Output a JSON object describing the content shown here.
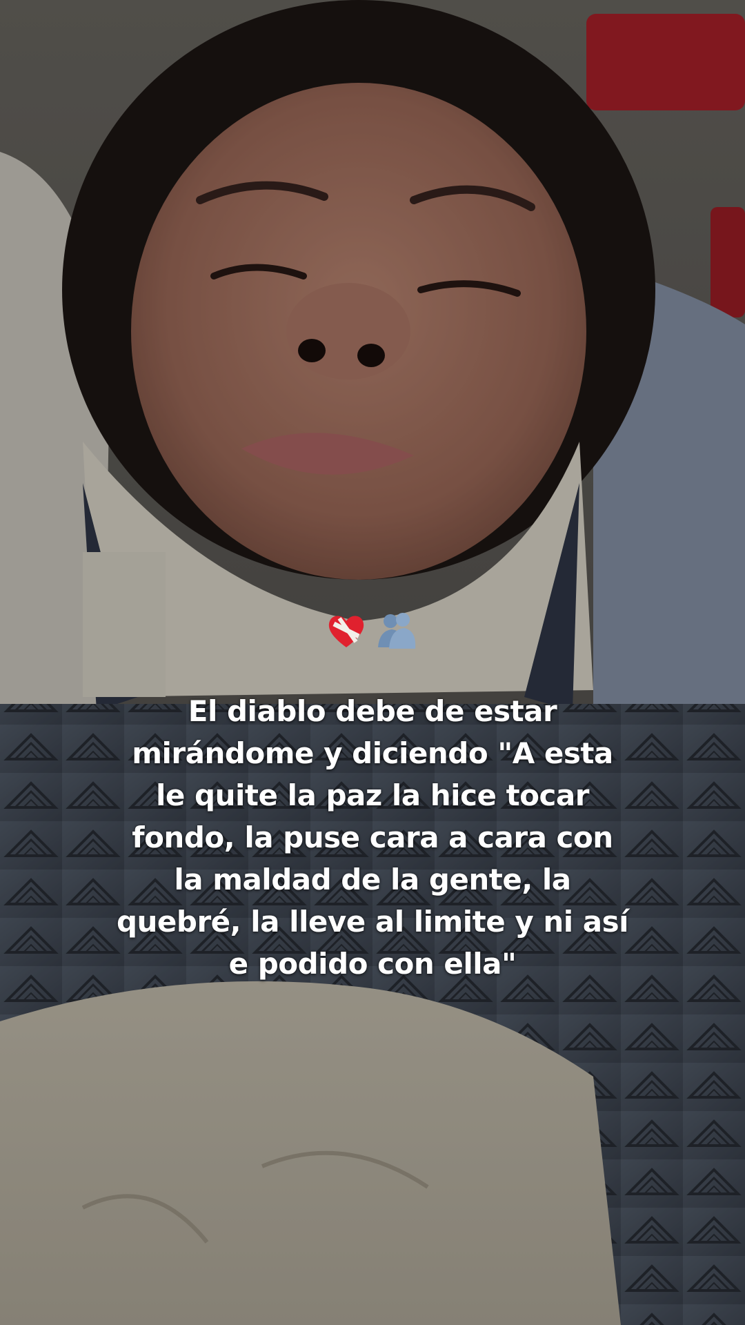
{
  "caption": {
    "text": "El diablo debe de estar\nmirándome y diciendo \"A esta\nle quite la paz la hice tocar\nfondo, la puse cara a cara con\nla maldad de la gente, la\nquebré, la lleve al limite y ni así\ne podido con ella\"",
    "emojis": [
      "mending-heart-emoji",
      "people-hugging-emoji"
    ],
    "color": "#ffffff"
  },
  "palette": {
    "skin": "#b07c6a",
    "hair": "#1e1714",
    "collar": "#e9e4d6",
    "gown": "#5b6472",
    "blanket": "#d8d2c3",
    "pillow": "#9aa6bc",
    "accent_red": "#c8262e"
  }
}
